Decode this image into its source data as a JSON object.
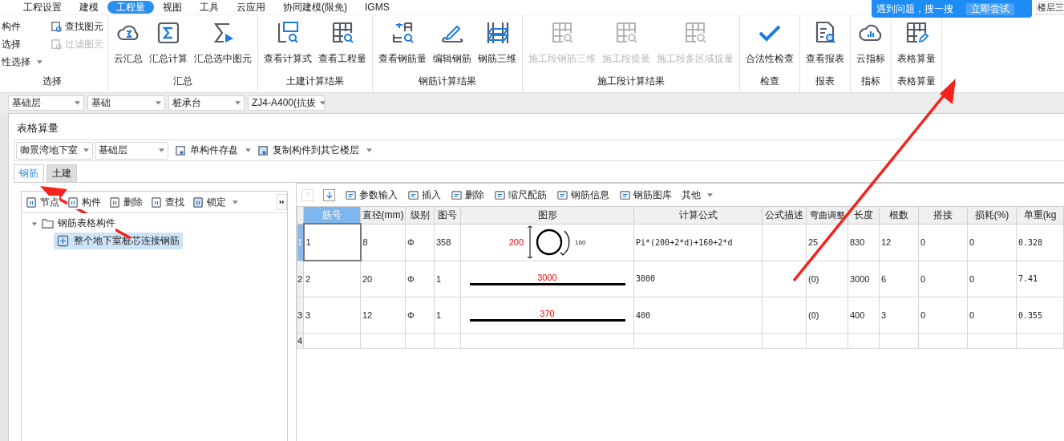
{
  "menu": [
    {
      "label": "工程设置",
      "selected": false
    },
    {
      "label": "建模",
      "selected": false
    },
    {
      "label": "工程量",
      "selected": true
    },
    {
      "label": "视图",
      "selected": false
    },
    {
      "label": "工具",
      "selected": false
    },
    {
      "label": "云应用",
      "selected": false
    },
    {
      "label": "协同建模(限免)",
      "selected": false
    },
    {
      "label": "IGMS",
      "selected": false
    }
  ],
  "help_tip": {
    "text": "遇到问题，搜一搜",
    "button": "立即尝试"
  },
  "floor_field": "楼层三",
  "selector_arrows": true,
  "ribbon": {
    "small_buttons": [
      {
        "label": "构件",
        "disabled": false,
        "dropdown": false
      },
      {
        "label": "选择",
        "disabled": false,
        "dropdown": false
      },
      {
        "label": "性选择",
        "disabled": false,
        "dropdown": true
      },
      {
        "label": "查找图元",
        "disabled": false,
        "dropdown": false
      },
      {
        "label": "过滤图元",
        "disabled": true,
        "dropdown": false
      }
    ],
    "groups": [
      {
        "label": "选择"
      },
      {
        "label": "汇总",
        "buttons": [
          {
            "label": "云汇总",
            "disabled": false
          },
          {
            "label": "汇总计算",
            "disabled": false
          },
          {
            "label": "汇总选中图元",
            "disabled": false
          }
        ]
      },
      {
        "label": "土建计算结果",
        "buttons": [
          {
            "label": "查看计算式",
            "disabled": false
          },
          {
            "label": "查看工程量",
            "disabled": false
          }
        ]
      },
      {
        "label": "钢筋计算结果",
        "buttons": [
          {
            "label": "查看钢筋量",
            "disabled": false
          },
          {
            "label": "编辑钢筋",
            "disabled": false
          },
          {
            "label": "钢筋三维",
            "disabled": false
          }
        ]
      },
      {
        "label": "施工段计算结果",
        "buttons": [
          {
            "label": "施工段钢筋三维",
            "disabled": true
          },
          {
            "label": "施工段提量",
            "disabled": true
          },
          {
            "label": "施工段多区域提量",
            "disabled": true
          }
        ]
      },
      {
        "label": "检查",
        "buttons": [
          {
            "label": "合法性检查",
            "disabled": false
          }
        ]
      },
      {
        "label": "报表",
        "buttons": [
          {
            "label": "查看报表",
            "disabled": false
          }
        ]
      },
      {
        "label": "指标",
        "buttons": [
          {
            "label": "云指标",
            "disabled": false
          }
        ]
      },
      {
        "label": "表格算量",
        "buttons": [
          {
            "label": "表格算量",
            "disabled": false
          }
        ]
      }
    ]
  },
  "selectors": [
    "基础层",
    "基础",
    "桩承台",
    "ZJ4-A400(抗拔"
  ],
  "panel": {
    "title": "表格算量",
    "selectors": [
      "御景湾地下室",
      "基础层"
    ],
    "actions": [
      "单构件存盘",
      "复制构件到其它楼层"
    ],
    "tabs": [
      {
        "label": "钢筋",
        "selected": true
      },
      {
        "label": "土建",
        "selected": false
      }
    ],
    "tree_toolbar": [
      {
        "label": "节点",
        "dropdown": false
      },
      {
        "label": "构件",
        "dropdown": false
      },
      {
        "label": "删除",
        "dropdown": false
      },
      {
        "label": "查找",
        "dropdown": false
      },
      {
        "label": "锁定",
        "dropdown": true
      }
    ],
    "tree": [
      {
        "label": "钢筋表格构件",
        "expanded": true,
        "selected": false,
        "children": [
          {
            "label": "整个地下室桩芯连接钢筋",
            "selected": true
          }
        ]
      }
    ],
    "move_buttons": [
      {
        "disabled": true
      },
      {
        "disabled": false
      }
    ],
    "grid_toolbar": [
      {
        "label": "参数输入",
        "dropdown": false
      },
      {
        "label": "插入",
        "dropdown": false
      },
      {
        "label": "删除",
        "dropdown": false
      },
      {
        "label": "缩尺配筋",
        "dropdown": false
      },
      {
        "label": "钢筋信息",
        "dropdown": false
      },
      {
        "label": "钢筋图库",
        "dropdown": false
      },
      {
        "label": "其他",
        "dropdown": true
      }
    ],
    "table": {
      "columns": [
        {
          "label": "筋号",
          "selected": true
        },
        {
          "label": "直径(mm)",
          "selected": false
        },
        {
          "label": "级别",
          "selected": false
        },
        {
          "label": "图号",
          "selected": false
        },
        {
          "label": "图形",
          "selected": false
        },
        {
          "label": "计算公式",
          "selected": false
        },
        {
          "label": "公式描述",
          "selected": false
        },
        {
          "label": "弯曲调整",
          "selected": false
        },
        {
          "label": "长度",
          "selected": false
        },
        {
          "label": "根数",
          "selected": false
        },
        {
          "label": "搭接",
          "selected": false
        },
        {
          "label": "损耗(%)",
          "selected": false
        },
        {
          "label": "单重(kg",
          "selected": false
        }
      ],
      "rows": [
        {
          "row_number": "1",
          "selected": true,
          "bar_no": "1",
          "diameter": "8",
          "grade": "Φ",
          "shape_no": "358",
          "shape": {
            "kind": "circle",
            "labels": [
              "200",
              "160"
            ]
          },
          "formula": "Pi*(200+2*d)+160+2*d",
          "bend": "25",
          "length": "830",
          "count": "12",
          "lap": "0",
          "loss": "0",
          "unit_weight": "0.328"
        },
        {
          "row_number": "2",
          "selected": false,
          "bar_no": "2",
          "diameter": "20",
          "grade": "Φ",
          "shape_no": "1",
          "shape": {
            "kind": "line",
            "labels": [
              "3000"
            ]
          },
          "formula": "3000",
          "bend": "(0)",
          "length": "3000",
          "count": "6",
          "lap": "0",
          "loss": "0",
          "unit_weight": "7.41"
        },
        {
          "row_number": "3",
          "selected": false,
          "bar_no": "3",
          "diameter": "12",
          "grade": "Φ",
          "shape_no": "1",
          "shape": {
            "kind": "line",
            "labels": [
              "370"
            ]
          },
          "formula": "400",
          "bend": "(0)",
          "length": "400",
          "count": "3",
          "lap": "0",
          "loss": "0",
          "unit_weight": "0.355"
        },
        {
          "row_number": "4",
          "selected": false
        }
      ]
    }
  }
}
